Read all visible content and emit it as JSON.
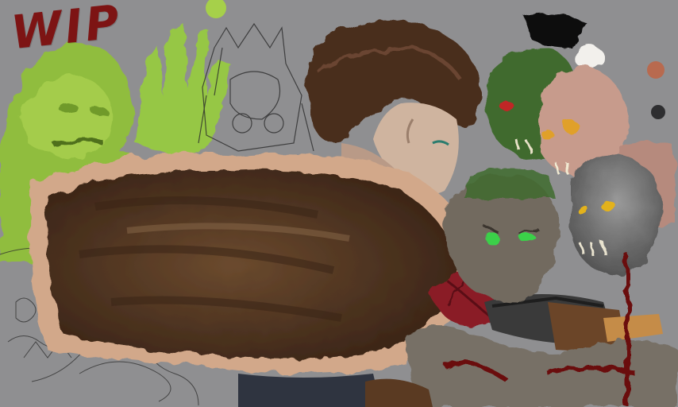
{
  "artwork": {
    "label": "WIP",
    "label_color": "#7d1414",
    "palette": {
      "background": "#8f8f91",
      "swatch_1": "#b86a4f",
      "swatch_2": "#2e2e30",
      "swatch_3": "#a6d04a",
      "goblin_green": "#8fbf3a",
      "cloak_brown": "#5e3f28",
      "fur_trim": "#d2a88a",
      "skin": "#cfb49f",
      "hair": "#4a2f1f",
      "red_armor": "#8a1f25",
      "orc_green": "#3f6b2e",
      "grey_ghoul": "#737272",
      "pale_ghoul": "#c79b8c"
    }
  }
}
